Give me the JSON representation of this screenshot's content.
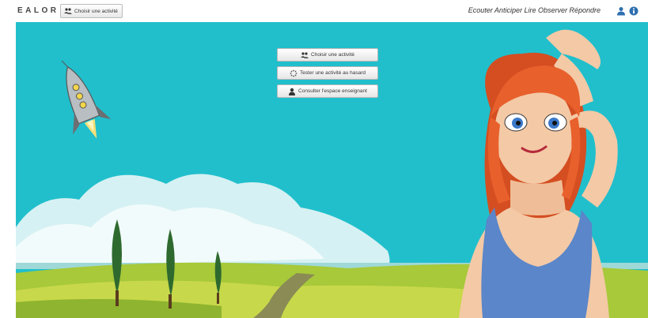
{
  "header": {
    "brand": "EALOR",
    "choose_button_label": "Choisir une activité",
    "tagline": "Ecouter Anticiper Lire Observer Répondre",
    "icons": [
      "user-icon",
      "info-icon"
    ]
  },
  "menu": {
    "items": [
      {
        "label": "Choisir une activité",
        "icon": "group-icon"
      },
      {
        "label": "Tester une activité au hasard",
        "icon": "spinner-icon"
      },
      {
        "label": "Consulter l'espace enseignant",
        "icon": "user-icon"
      }
    ]
  },
  "colors": {
    "sky": "#21bfcc",
    "accent_icon": "#2d6fb0",
    "hair": "#e8602c",
    "dress": "#5b86c9"
  }
}
